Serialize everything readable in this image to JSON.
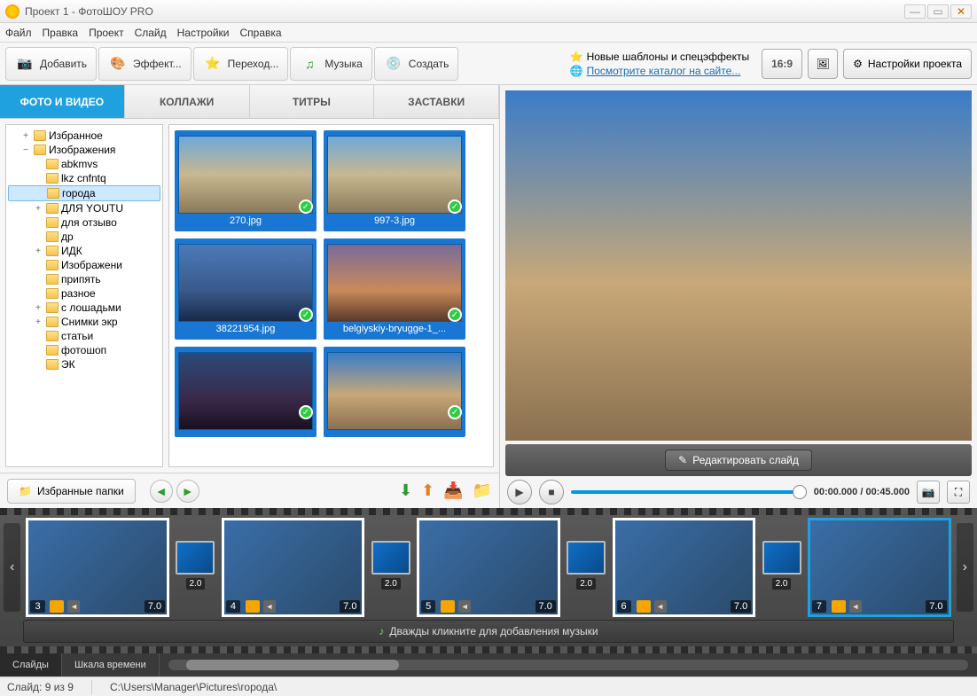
{
  "window": {
    "title": "Проект 1 - ФотоШОУ PRO"
  },
  "menu": [
    "Файл",
    "Правка",
    "Проект",
    "Слайд",
    "Настройки",
    "Справка"
  ],
  "toolbar": {
    "add": "Добавить",
    "effects": "Эффект...",
    "transitions": "Переход...",
    "music": "Музыка",
    "create": "Создать",
    "info1": "Новые шаблоны и спецэффекты",
    "info2": "Посмотрите каталог на сайте...",
    "aspect": "16:9",
    "settings": "Настройки проекта"
  },
  "subtabs": {
    "photos": "ФОТО И ВИДЕО",
    "collages": "КОЛЛАЖИ",
    "titles": "ТИТРЫ",
    "splash": "ЗАСТАВКИ"
  },
  "tree": [
    {
      "level": 1,
      "exp": "+",
      "label": "Избранное"
    },
    {
      "level": 1,
      "exp": "−",
      "label": "Изображения"
    },
    {
      "level": 2,
      "exp": "",
      "label": "abkmvs"
    },
    {
      "level": 2,
      "exp": "",
      "label": "lkz cnfntq"
    },
    {
      "level": 2,
      "exp": "",
      "label": "города",
      "sel": true
    },
    {
      "level": 2,
      "exp": "+",
      "label": "ДЛЯ YOUTU"
    },
    {
      "level": 2,
      "exp": "",
      "label": "для отзыво"
    },
    {
      "level": 2,
      "exp": "",
      "label": "др"
    },
    {
      "level": 2,
      "exp": "+",
      "label": "ИДК"
    },
    {
      "level": 2,
      "exp": "",
      "label": "Изображени"
    },
    {
      "level": 2,
      "exp": "",
      "label": "припять"
    },
    {
      "level": 2,
      "exp": "",
      "label": "разное"
    },
    {
      "level": 2,
      "exp": "+",
      "label": "с лошадьми"
    },
    {
      "level": 2,
      "exp": "+",
      "label": "Снимки экр"
    },
    {
      "level": 2,
      "exp": "",
      "label": "статьи"
    },
    {
      "level": 2,
      "exp": "",
      "label": "фотошоп"
    },
    {
      "level": 2,
      "exp": "",
      "label": "ЭК"
    }
  ],
  "thumbs": [
    {
      "name": "270.jpg",
      "sc": "sc1"
    },
    {
      "name": "997-3.jpg",
      "sc": "sc1"
    },
    {
      "name": "38221954.jpg",
      "sc": "sc2"
    },
    {
      "name": "belgiyskiy-bryugge-1_...",
      "sc": "sc3"
    },
    {
      "name": "",
      "sc": "sc4"
    },
    {
      "name": "",
      "sc": "sc5"
    }
  ],
  "fav_button": "Избранные папки",
  "preview": {
    "edit": "Редактировать слайд",
    "time": "00:00.000 / 00:45.000"
  },
  "slides": [
    {
      "num": "3",
      "dur": "7.0",
      "sc": "sc1"
    },
    {
      "num": "4",
      "dur": "7.0",
      "sc": "sc2"
    },
    {
      "num": "5",
      "dur": "7.0",
      "sc": "sc3"
    },
    {
      "num": "6",
      "dur": "7.0",
      "sc": "sc4"
    },
    {
      "num": "7",
      "dur": "7.0",
      "sc": "sc4",
      "sel": true
    }
  ],
  "transition_dur": "2.0",
  "music_hint": "Дважды кликните для добавления музыки",
  "view_tabs": {
    "slides": "Слайды",
    "timeline": "Шкала времени"
  },
  "status": {
    "slide": "Слайд: 9 из 9",
    "path": "C:\\Users\\Manager\\Pictures\\города\\"
  }
}
